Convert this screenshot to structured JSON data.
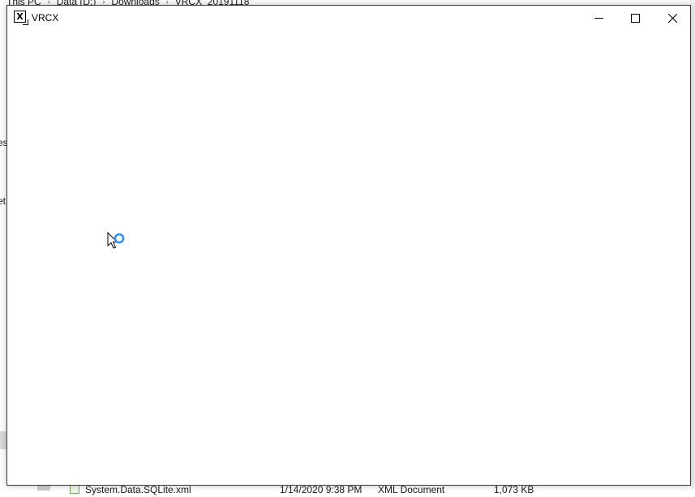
{
  "background_window": {
    "breadcrumb": [
      "This PC",
      "Data (D:)",
      "Downloads",
      "VRCX_20191118"
    ],
    "breadcrumb_separator": "›",
    "nav_peek": [
      "es",
      "et"
    ],
    "file_row": {
      "name": "System.Data.SQLite.xml",
      "date": "1/14/2020 9:38 PM",
      "type": "XML Document",
      "size": "1,073 KB"
    }
  },
  "window": {
    "title": "VRCX",
    "app_icon_letter": "X",
    "icons": {
      "app": "vrcx-app-icon",
      "minimize": "minimize-icon",
      "maximize": "maximize-icon",
      "close": "close-icon",
      "cursor": "busy-cursor-icon"
    },
    "accent_color": "#3391f5"
  }
}
